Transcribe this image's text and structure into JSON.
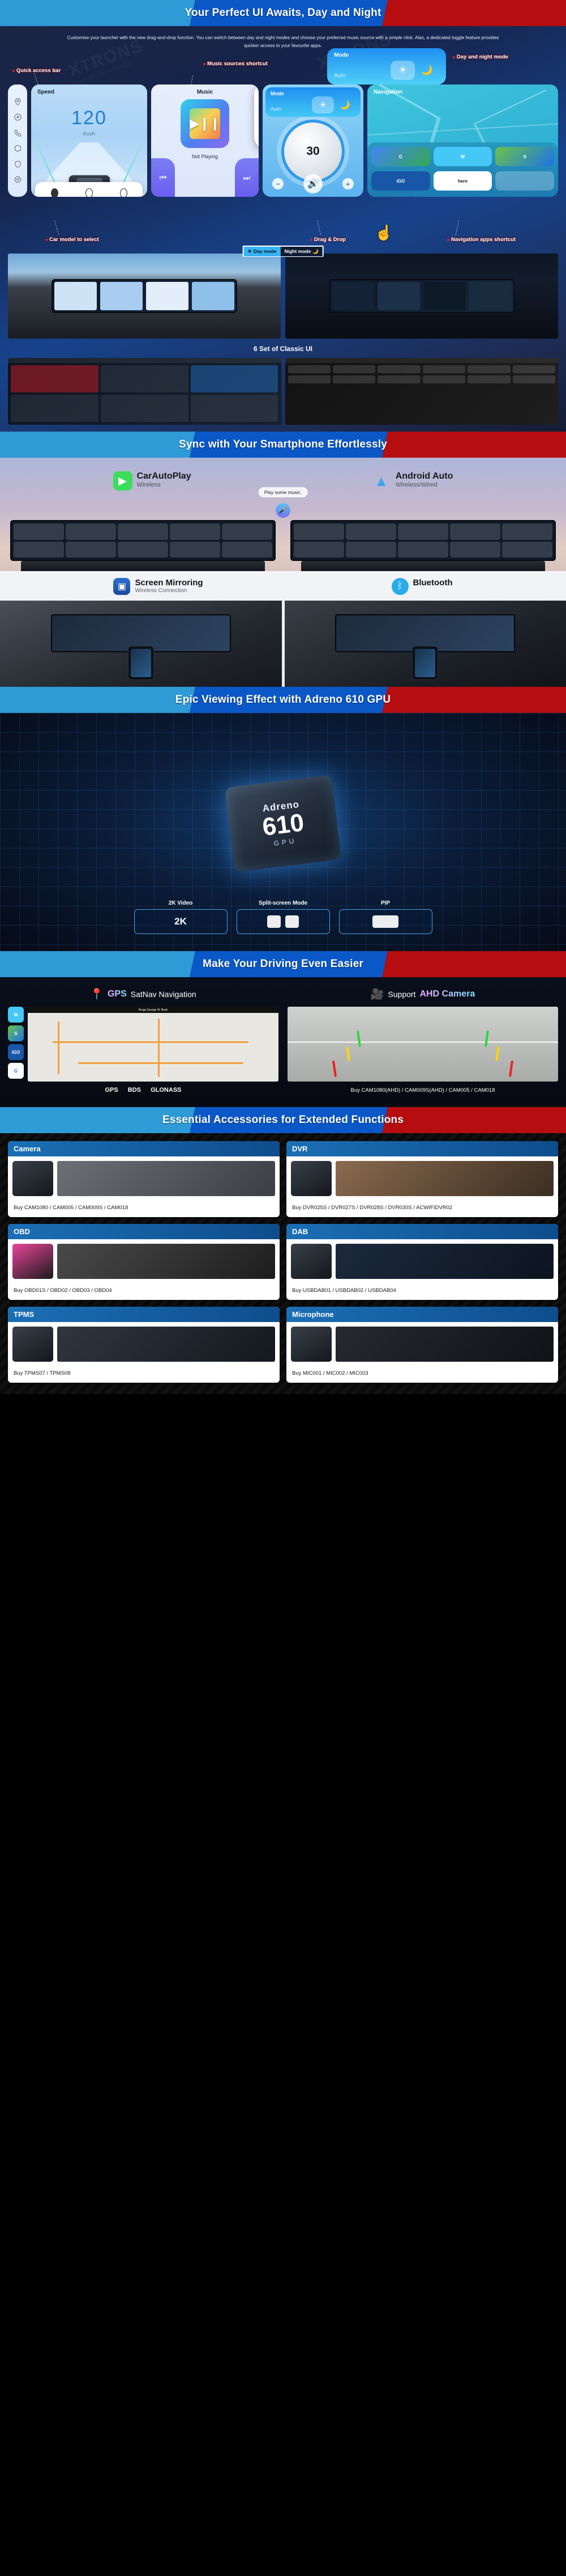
{
  "sections": {
    "ui": {
      "banner": "Your Perfect UI Awaits, Day and Night",
      "description": "Customise your launcher with the new drag-and-drop function. You can switch between day and night modes and choose your preferred music source with a simple click. Also, a dedicated toggle feature provides quicker access to your favourite apps.",
      "callouts": {
        "quick_access": "Quick access bar",
        "music_sources": "Music sources shortcut",
        "day_night": "Day and night mode",
        "car_model": "Car model to select",
        "drag_drop": "Drag & Drop",
        "nav_apps": "Navigation apps shortcut"
      },
      "widgets": {
        "speed_title": "Speed",
        "speed_value": "120",
        "speed_unit": "Km/h",
        "music_title": "Music",
        "music_status": "Not Playing",
        "mode_title": "Mode",
        "mode_auto": "Auto",
        "volume_value": "30",
        "nav_title": "Navigation",
        "nav_apps": [
          "Maps",
          "Waze",
          "Sygic",
          "iGO",
          "here"
        ]
      },
      "toggle": {
        "day": "Day mode",
        "night": "Night mode"
      },
      "classic_title": "6 Set of Classic UI"
    },
    "sync": {
      "banner": "Sync with Your Smartphone Effortlessly",
      "carplay": {
        "name": "CarAutoPlay",
        "sub": "Wireless"
      },
      "androidauto": {
        "name": "Android Auto",
        "sub": "Wireless/Wired"
      },
      "voice_bubble": "Play some music.",
      "mirroring": {
        "name": "Screen Mirroring",
        "sub": "Wireless Connection"
      },
      "bluetooth": {
        "name": "Bluetooth",
        "sub": ""
      }
    },
    "gpu": {
      "banner": "Epic Viewing Effect with Adreno 610 GPU",
      "chip_brand": "Adreno",
      "chip_number": "610",
      "chip_gpu_label": "GPU",
      "features": [
        {
          "label": "2K Video",
          "value": "2K"
        },
        {
          "label": "Split-screen Mode",
          "value": ""
        },
        {
          "label": "PIP",
          "value": ""
        }
      ]
    },
    "driving": {
      "banner": "Make Your Driving Even Easier",
      "gps": {
        "title_accent": "GPS",
        "title_rest": "SatNav Navigation",
        "systems": [
          "GPS",
          "BDS",
          "GLONASS"
        ],
        "apps": [
          "Waze",
          "Sygic",
          "iGO",
          "Maps"
        ]
      },
      "ahd": {
        "title_pre": "Support",
        "title_accent": "AHD Camera",
        "buy": "Buy CAM1080(AHD) / CAM009S(AHD) / CAM005 / CAM018"
      }
    },
    "accessories": {
      "banner": "Essential Accessories for Extended Functions",
      "items": [
        {
          "title": "Camera",
          "buy": "Buy CAM1080 / CAM005 / CAM009S / CAM018"
        },
        {
          "title": "DVR",
          "buy": "Buy DVR025S / DVR027S / DVR028S / DVR030S / ACWIFIDVR02"
        },
        {
          "title": "OBD",
          "buy": "Buy OBD01S / OBD02 / OBD03 / OBD04"
        },
        {
          "title": "DAB",
          "buy": "Buy USBDAB01 / USBDAB02 / USBDAB04"
        },
        {
          "title": "TPMS",
          "buy": "Buy TPMS07 / TPMS08"
        },
        {
          "title": "Microphone",
          "buy": "Buy MIC001 / MIC002 / MIC003"
        }
      ]
    }
  },
  "watermark": {
    "text": "XTRONS",
    "sub": "copyright by xtrons|||||"
  }
}
